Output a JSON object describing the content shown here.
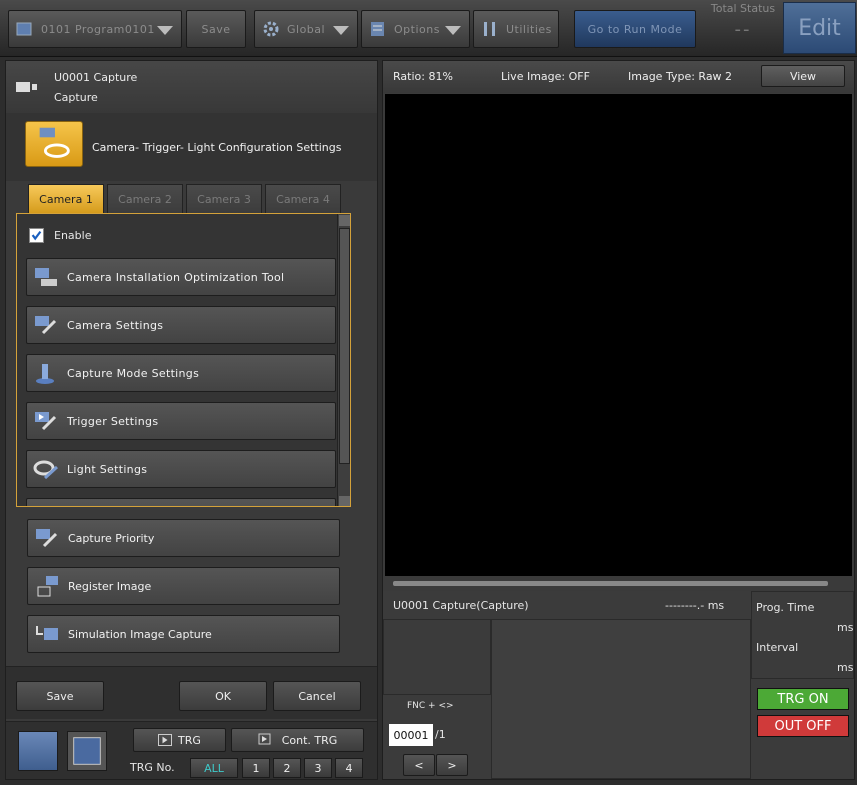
{
  "topbar": {
    "program": "0101 Program0101",
    "save": "Save",
    "global": "Global",
    "options": "Options",
    "utilities": "Utilities",
    "run_mode": "Go to Run Mode",
    "total_status_label": "Total Status",
    "total_status_value": "--",
    "edit": "Edit"
  },
  "unit": {
    "id_name": "U0001 Capture",
    "sub": "Capture"
  },
  "config_title": "Camera- Trigger- Light Configuration Settings",
  "tabs": [
    "Camera 1",
    "Camera 2",
    "Camera 3",
    "Camera 4"
  ],
  "enable": {
    "label": "Enable",
    "checked": true
  },
  "items": [
    "Camera Installation Optimization Tool",
    "Camera Settings",
    "Capture Mode Settings",
    "Trigger Settings",
    "Light Settings"
  ],
  "outer_items": [
    "Capture Priority",
    "Register Image",
    "Simulation Image Capture"
  ],
  "buttons": {
    "save": "Save",
    "ok": "OK",
    "cancel": "Cancel"
  },
  "trigger": {
    "trg": "TRG",
    "cont": "Cont. TRG",
    "trg_no": "TRG No.",
    "nums": [
      "ALL",
      "1",
      "2",
      "3",
      "4"
    ]
  },
  "viewer": {
    "ratio": "Ratio: 81%",
    "live": "Live Image: OFF",
    "type": "Image Type: Raw 2",
    "view": "View"
  },
  "timing": {
    "unit_label": "U0001 Capture(Capture)",
    "time_value": "--------.- ms",
    "prog_time": "Prog. Time",
    "ms1": "ms",
    "interval": "Interval",
    "ms2": "ms",
    "fnc": "FNC + <>",
    "counter": "00001",
    "counter_total": "/1",
    "prev": "<",
    "next": ">",
    "trg_on": "TRG ON",
    "out_off": "OUT OFF"
  },
  "colors": {
    "accent": "#e8b13a",
    "trg_on": "#4caf3a",
    "out_off": "#d03a3a",
    "run_mode": "#2a4a78"
  }
}
